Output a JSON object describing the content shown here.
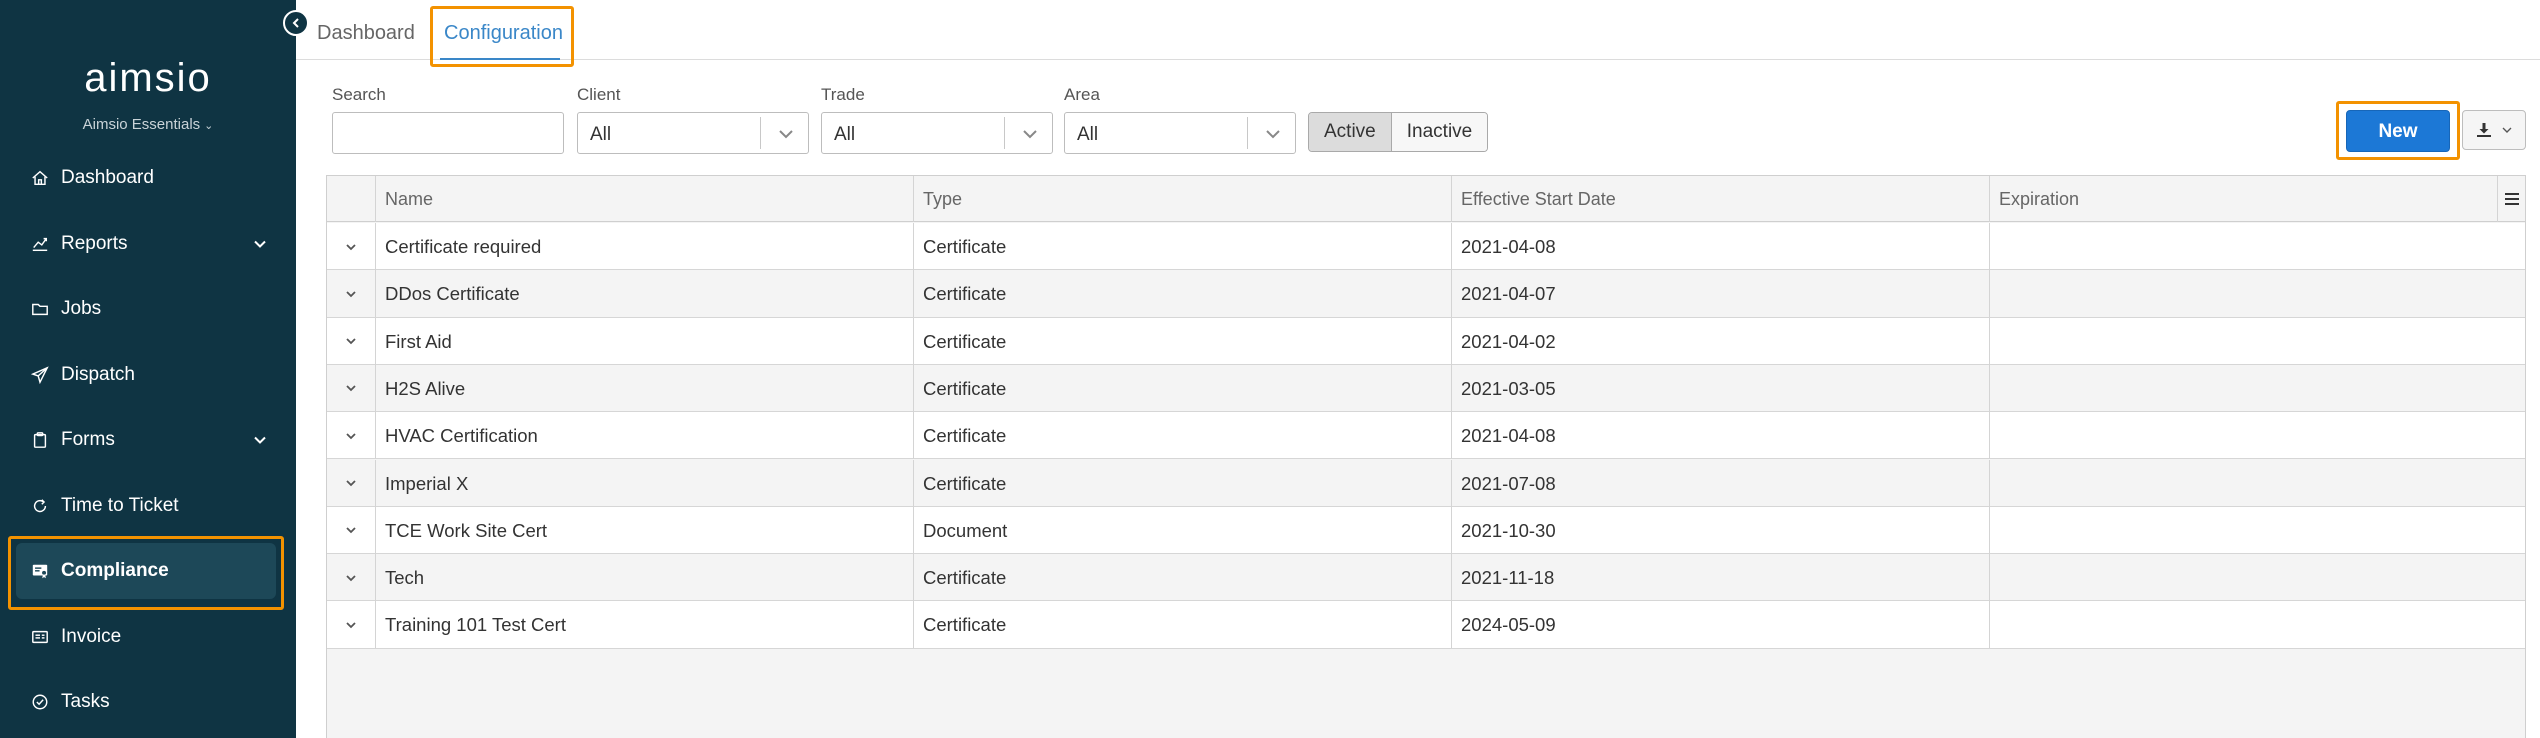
{
  "sidebar": {
    "logo": "aimsio",
    "org": "Aimsio Essentials",
    "items": [
      {
        "label": "Dashboard"
      },
      {
        "label": "Reports"
      },
      {
        "label": "Jobs"
      },
      {
        "label": "Dispatch"
      },
      {
        "label": "Forms"
      },
      {
        "label": "Time to Ticket"
      },
      {
        "label": "Compliance"
      },
      {
        "label": "Invoice"
      },
      {
        "label": "Tasks"
      }
    ]
  },
  "tabs": [
    {
      "label": "Dashboard"
    },
    {
      "label": "Configuration"
    }
  ],
  "filters": {
    "search_label": "Search",
    "search_value": "",
    "client_label": "Client",
    "client_value": "All",
    "trade_label": "Trade",
    "trade_value": "All",
    "area_label": "Area",
    "area_value": "All",
    "active_label": "Active",
    "inactive_label": "Inactive"
  },
  "toolbar": {
    "new_label": "New"
  },
  "table": {
    "columns": [
      "Name",
      "Type",
      "Effective Start Date",
      "Expiration"
    ],
    "rows": [
      {
        "name": "Certificate required",
        "type": "Certificate",
        "start": "2021-04-08",
        "expiration": ""
      },
      {
        "name": "DDos Certificate",
        "type": "Certificate",
        "start": "2021-04-07",
        "expiration": ""
      },
      {
        "name": "First Aid",
        "type": "Certificate",
        "start": "2021-04-02",
        "expiration": ""
      },
      {
        "name": "H2S Alive",
        "type": "Certificate",
        "start": "2021-03-05",
        "expiration": ""
      },
      {
        "name": "HVAC Certification",
        "type": "Certificate",
        "start": "2021-04-08",
        "expiration": ""
      },
      {
        "name": "Imperial X",
        "type": "Certificate",
        "start": "2021-07-08",
        "expiration": ""
      },
      {
        "name": "TCE Work Site Cert",
        "type": "Document",
        "start": "2021-10-30",
        "expiration": ""
      },
      {
        "name": "Tech",
        "type": "Certificate",
        "start": "2021-11-18",
        "expiration": ""
      },
      {
        "name": "Training 101 Test Cert",
        "type": "Certificate",
        "start": "2024-05-09",
        "expiration": ""
      }
    ]
  },
  "colors": {
    "sidebar_bg": "#0f3443",
    "accent": "#3a87c8",
    "primary_button": "#1c78d6",
    "highlight": "#f39200"
  }
}
